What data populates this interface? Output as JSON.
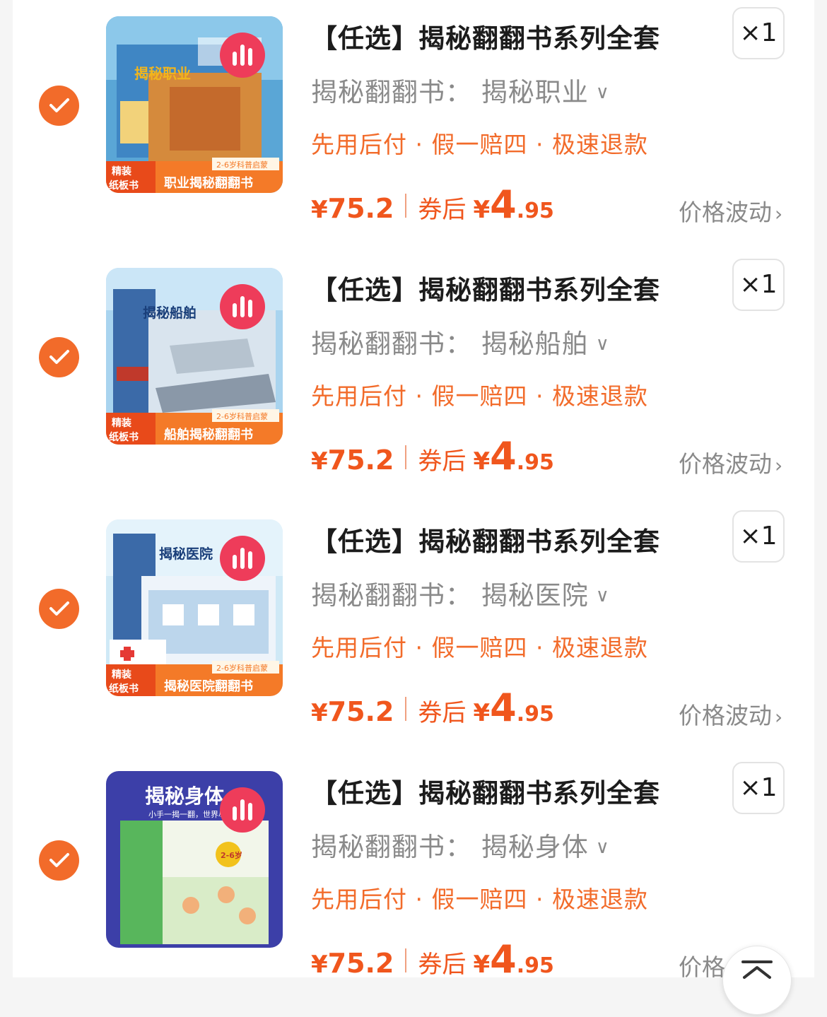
{
  "colors": {
    "accent": "#f26b2a",
    "price": "#f0561d",
    "title": "#1c1c1c",
    "muted": "#8a8a8a"
  },
  "items": [
    {
      "title": "【任选】揭秘翻翻书系列全套",
      "quantity": "×1",
      "spec": "揭秘翻翻书：  揭秘职业",
      "service": "先用后付 · 假一赔四 · 极速退款",
      "price_symbol": "¥",
      "price": "75.2",
      "coupon_label": "券后",
      "coupon_symbol": "¥",
      "coupon_price_int": "4",
      "coupon_price_dec": ".95",
      "fluct_label": "价格波动",
      "cover": {
        "top_label": "揭秘职业",
        "age": "2-6岁科普启蒙",
        "badge": "精装纸板书",
        "bottom_label": "职业揭秘翻翻书"
      }
    },
    {
      "title": "【任选】揭秘翻翻书系列全套",
      "quantity": "×1",
      "spec": "揭秘翻翻书：  揭秘船舶",
      "service": "先用后付 · 假一赔四 · 极速退款",
      "price_symbol": "¥",
      "price": "75.2",
      "coupon_label": "券后",
      "coupon_symbol": "¥",
      "coupon_price_int": "4",
      "coupon_price_dec": ".95",
      "fluct_label": "价格波动",
      "cover": {
        "top_label": "揭秘船舶",
        "age": "2-6岁科普启蒙",
        "badge": "精装纸板书",
        "bottom_label": "船舶揭秘翻翻书"
      }
    },
    {
      "title": "【任选】揭秘翻翻书系列全套",
      "quantity": "×1",
      "spec": "揭秘翻翻书：  揭秘医院",
      "service": "先用后付 · 假一赔四 · 极速退款",
      "price_symbol": "¥",
      "price": "75.2",
      "coupon_label": "券后",
      "coupon_symbol": "¥",
      "coupon_price_int": "4",
      "coupon_price_dec": ".95",
      "fluct_label": "价格波动",
      "cover": {
        "top_label": "揭秘医院",
        "age": "2-6岁科普启蒙",
        "badge": "精装纸板书",
        "bottom_label": "揭秘医院翻翻书"
      }
    },
    {
      "title": "【任选】揭秘翻翻书系列全套",
      "quantity": "×1",
      "spec": "揭秘翻翻书：  揭秘身体",
      "service": "先用后付 · 假一赔四 · 极速退款",
      "price_symbol": "¥",
      "price": "75.2",
      "coupon_label": "券后",
      "coupon_symbol": "¥",
      "coupon_price_int": "4",
      "coupon_price_dec": ".95",
      "fluct_label": "价格",
      "cover": {
        "top_label": "揭秘身体",
        "age": "2-6岁",
        "badge": "",
        "bottom_label": "小手一揭一翻，世界尽在眼前"
      }
    }
  ],
  "icons": {
    "check": "check-icon",
    "chart": "bar-chart-icon",
    "chevron_down": "chevron-down-icon",
    "chevron_right": "chevron-right-icon",
    "scroll_top": "scroll-to-top-icon"
  }
}
